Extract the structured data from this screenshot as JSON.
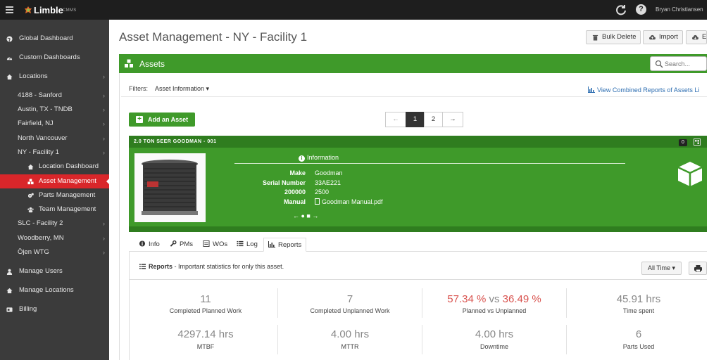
{
  "app": {
    "logo": "Limble",
    "logo_sub": "CMMS",
    "user": "Bryan Christiansen"
  },
  "sidebar": {
    "items": [
      {
        "label": "Global Dashboard",
        "icon": "globe-icon"
      },
      {
        "label": "Custom Dashboards",
        "icon": "dashboard-icon"
      },
      {
        "label": "Locations",
        "icon": "home-icon"
      },
      {
        "label": "4188 - Sanford"
      },
      {
        "label": "Austin, TX - TNDB"
      },
      {
        "label": "Fairfield, NJ"
      },
      {
        "label": "North Vancouver"
      },
      {
        "label": "NY - Facility 1"
      },
      {
        "label": "Location Dashboard",
        "icon": "home-icon"
      },
      {
        "label": "Asset Management",
        "icon": "cubes-icon"
      },
      {
        "label": "Parts Management",
        "icon": "gears-icon"
      },
      {
        "label": "Team Management",
        "icon": "team-icon"
      },
      {
        "label": "SLC - Facility 2"
      },
      {
        "label": "Woodberry, MN"
      },
      {
        "label": "Öjen WTG"
      },
      {
        "label": "Manage Users",
        "icon": "user-icon"
      },
      {
        "label": "Manage Locations",
        "icon": "home-icon"
      },
      {
        "label": "Billing",
        "icon": "billing-icon"
      }
    ]
  },
  "header": {
    "title": "Asset Management - NY - Facility 1",
    "bulk_delete": "Bulk Delete",
    "import": "Import",
    "export": "E"
  },
  "assets_panel": {
    "title": "Assets",
    "search_placeholder": "Search...",
    "filters_label": "Filters:",
    "filters_value": "Asset Information",
    "view_reports": "View Combined Reports of Assets Li",
    "add_button": "Add an Asset",
    "pagination": {
      "prev": "←",
      "pages": [
        "1",
        "2"
      ],
      "next": "→",
      "current": "1"
    }
  },
  "asset": {
    "name": "2.0 TON SEER GOODMAN - 001",
    "count": "0",
    "info_title": "Information",
    "fields": [
      {
        "key": "Make",
        "value": "Goodman"
      },
      {
        "key": "Serial Number",
        "value": "33AE221"
      },
      {
        "key": "200000",
        "value": "2500"
      },
      {
        "key": "Manual",
        "value": "Goodman Manual.pdf"
      }
    ],
    "carousel": "← ● ■ →"
  },
  "tabs": [
    {
      "label": "Info",
      "icon": "info-icon"
    },
    {
      "label": "PMs",
      "icon": "wrench-icon"
    },
    {
      "label": "WOs",
      "icon": "work-order-icon"
    },
    {
      "label": "Log",
      "icon": "list-icon"
    },
    {
      "label": "Reports",
      "icon": "bar-chart-icon",
      "active": true
    }
  ],
  "reports": {
    "title": "Reports",
    "subtitle": " - Important statistics for only this asset.",
    "range": "All Time"
  },
  "stats": {
    "completed_planned": {
      "value": "11",
      "label": "Completed Planned Work"
    },
    "completed_unplanned": {
      "value": "7",
      "label": "Completed Unplanned Work"
    },
    "planned_vs_unplanned": {
      "planned": "57.34 %",
      "vs": " vs ",
      "unplanned": "36.49 %",
      "label": "Planned vs Unplanned"
    },
    "time_spent": {
      "value": "45.91 hrs",
      "label": "Time spent"
    },
    "mtbf": {
      "value": "4297.14 hrs",
      "label": "MTBF"
    },
    "mttr": {
      "value": "4.00 hrs",
      "label": "MTTR"
    },
    "downtime": {
      "value": "4.00 hrs",
      "label": "Downtime"
    },
    "parts_used": {
      "value": "6",
      "label": "Parts Used"
    }
  },
  "colors": {
    "sidebar": "#3b3b3b",
    "topbar": "#1e1e1e",
    "green": "#3f9a2a",
    "dark_green": "#2f7d1f",
    "active_red": "#d9262a"
  }
}
